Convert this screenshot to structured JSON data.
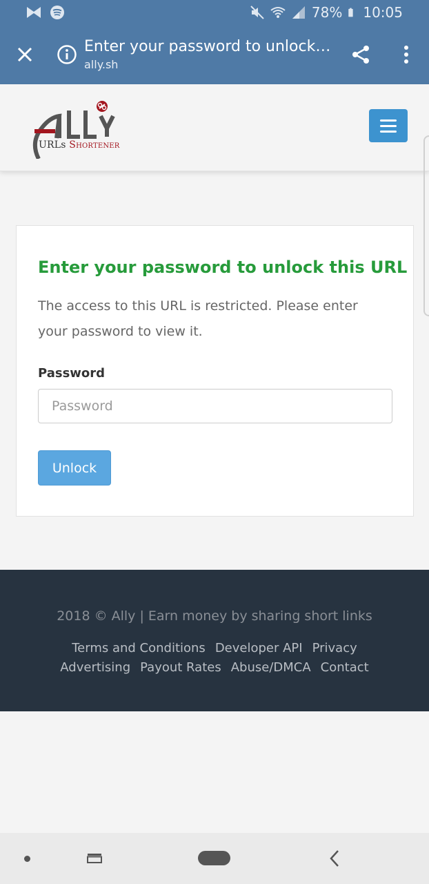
{
  "status_bar": {
    "battery": "78%",
    "time": "10:05"
  },
  "toolbar": {
    "page_title": "Enter your password to unlock th...",
    "domain": "ally.sh"
  },
  "site_header": {
    "logo_text": "Ally",
    "logo_subtitle_prefix": "URLs",
    "logo_subtitle_rest": "Shortener"
  },
  "card": {
    "title": "Enter your password to unlock this URL",
    "description": "The access to this URL is restricted. Please enter your password to view it.",
    "password_label": "Password",
    "password_placeholder": "Password",
    "unlock_label": "Unlock"
  },
  "footer": {
    "copyright": "2018 © Ally | Earn money by sharing short links",
    "links": [
      "Terms and Conditions",
      "Developer API",
      "Privacy",
      "Advertising",
      "Payout Rates",
      "Abuse/DMCA",
      "Contact"
    ]
  },
  "colors": {
    "toolbar_bg": "#4f7aa6",
    "title_green": "#279b3b",
    "button_blue": "#5ba7e0",
    "hamburger_blue": "#3d93cf",
    "footer_bg": "#273340",
    "logo_red": "#a3161f"
  },
  "icons": {
    "status_left": [
      "bowtie-notification-icon",
      "spotify-icon"
    ],
    "status_right": [
      "mute-icon",
      "wifi-icon",
      "signal-icon",
      "battery-icon"
    ],
    "toolbar": [
      "close-icon",
      "info-icon",
      "share-icon",
      "more-vert-icon"
    ],
    "navbar": [
      "dot-icon",
      "recents-icon",
      "home-icon",
      "back-icon"
    ]
  }
}
